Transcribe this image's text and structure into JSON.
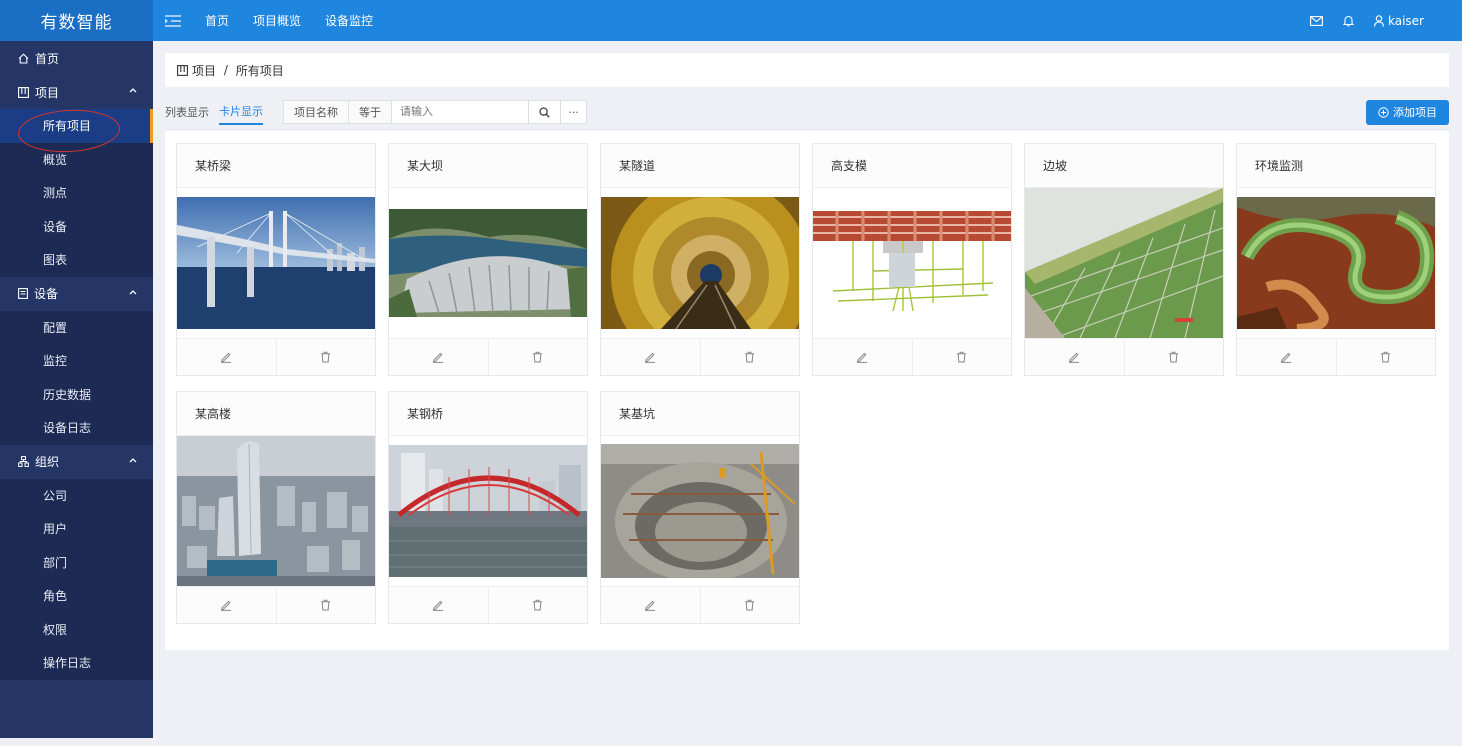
{
  "app": {
    "brand": "有数智能"
  },
  "topnav": {
    "items": [
      "首页",
      "项目概览",
      "设备监控"
    ]
  },
  "user": {
    "name": "kaiser"
  },
  "sidebar": {
    "home": "首页",
    "groups": [
      {
        "label": "项目",
        "items": [
          "所有项目",
          "概览",
          "测点",
          "设备",
          "图表"
        ]
      },
      {
        "label": "设备",
        "items": [
          "配置",
          "监控",
          "历史数据",
          "设备日志"
        ]
      },
      {
        "label": "组织",
        "items": [
          "公司",
          "用户",
          "部门",
          "角色",
          "权限",
          "操作日志"
        ]
      }
    ]
  },
  "breadcrumb": {
    "parent": "项目",
    "sep": " / ",
    "current": "所有项目"
  },
  "toolbar": {
    "list_view": "列表显示",
    "card_view": "卡片显示",
    "field": "项目名称",
    "op": "等于",
    "placeholder": "请输入",
    "more": "···",
    "add_label": "添加项目"
  },
  "projects": [
    "某桥梁",
    "某大坝",
    "某隧道",
    "高支模",
    "边坡",
    "环境监测",
    "某高楼",
    "某钢桥",
    "某基坑"
  ],
  "colors": {
    "primary": "#1f86e0",
    "sidebar": "#243566",
    "active_bar": "#f39b1a"
  }
}
